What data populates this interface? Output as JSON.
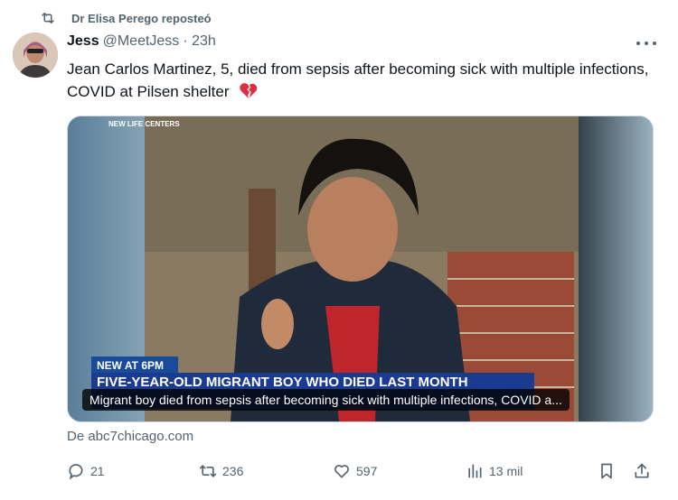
{
  "repost": {
    "label": "Dr Elisa Perego reposteó"
  },
  "author": {
    "name": "Jess",
    "handle": "@MeetJess",
    "time": "· 23h"
  },
  "tweet": {
    "text": "Jean Carlos Martinez, 5, died from sepsis after becoming sick with multiple infections, COVID at Pilsen shelter"
  },
  "media": {
    "overlay_top": "NEW LIFE CENTERS",
    "news_tag": "NEW AT 6PM",
    "news_headline": "FIVE-YEAR-OLD MIGRANT BOY WHO DIED LAST MONTH",
    "caption": "Migrant boy died from sepsis after becoming sick with multiple infections, COVID a..."
  },
  "source": "De abc7chicago.com",
  "actions": {
    "replies": "21",
    "reposts": "236",
    "likes": "597",
    "views": "13 mil"
  },
  "colors": {
    "secondary_text": "#536471",
    "primary_text": "#0f1419",
    "repost_green": "#00ba7c"
  }
}
